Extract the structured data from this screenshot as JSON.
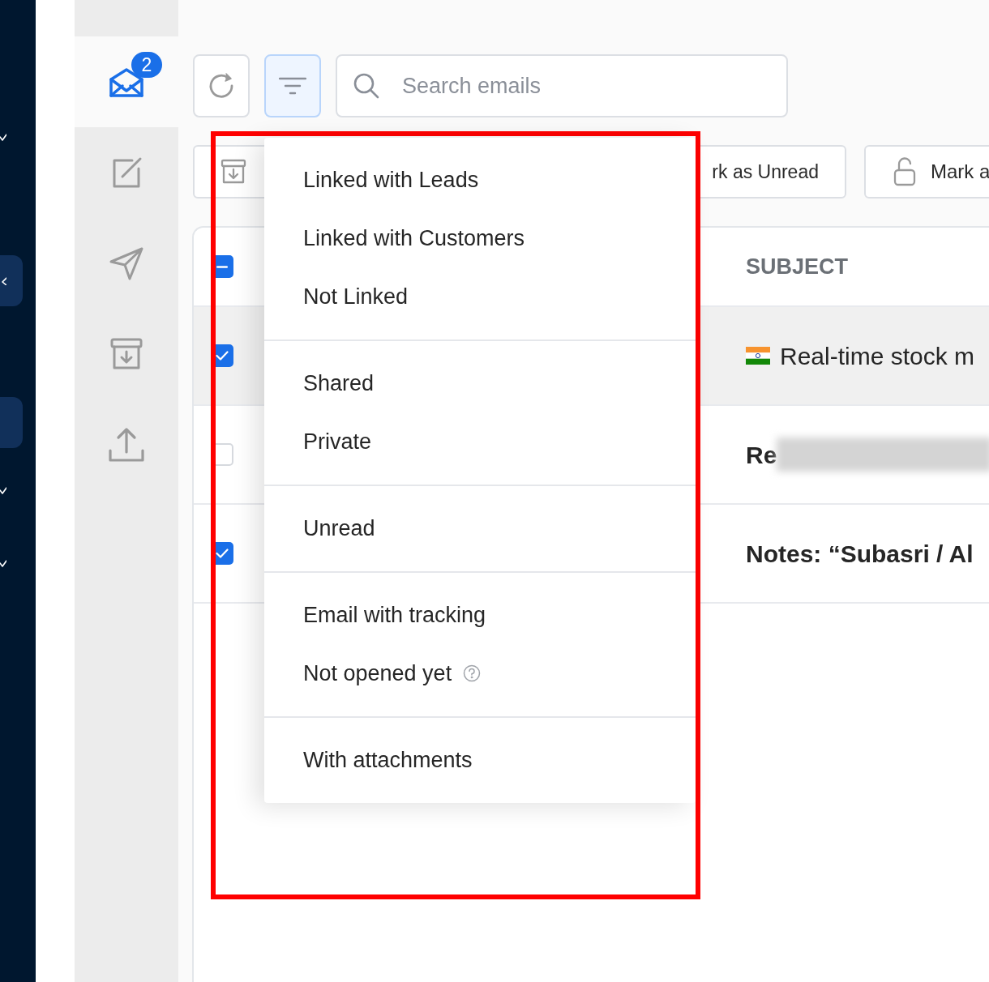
{
  "outer_nav": {
    "items": [
      {
        "kind": "expand",
        "selected": false
      },
      {
        "kind": "collapse",
        "selected": true
      },
      {
        "kind": "plain",
        "selected": true
      },
      {
        "kind": "expand",
        "selected": false
      },
      {
        "kind": "expand",
        "selected": false
      }
    ]
  },
  "rail": {
    "items": [
      {
        "kind": "inbox",
        "selected": true,
        "badge": "2"
      },
      {
        "kind": "compose",
        "selected": false
      },
      {
        "kind": "send",
        "selected": false
      },
      {
        "kind": "archive",
        "selected": false
      },
      {
        "kind": "upload",
        "selected": false
      }
    ]
  },
  "toolbar": {
    "filter_selected": true,
    "search": {
      "placeholder": "Search emails"
    }
  },
  "actions": [
    {
      "kind": "archive"
    },
    {
      "kind": "unread",
      "label": "rk as Unread"
    },
    {
      "kind": "lock",
      "label": "Mark a"
    }
  ],
  "table": {
    "header_checkbox": {
      "indeterminate": true
    },
    "columns": [
      "SUBJECT"
    ],
    "rows": [
      {
        "checked": true,
        "selected": true,
        "unread": false,
        "flag": true,
        "subject": "Real-time stock m"
      },
      {
        "checked": false,
        "selected": false,
        "unread": true,
        "redacted": true,
        "subject": "Re"
      },
      {
        "checked": true,
        "selected": false,
        "unread": true,
        "subject": "Notes: “Subasri / Al"
      }
    ]
  },
  "filter_menu": {
    "groups": [
      {
        "items": [
          {
            "label": "Linked with Leads"
          },
          {
            "label": "Linked with Customers"
          },
          {
            "label": "Not Linked"
          }
        ]
      },
      {
        "items": [
          {
            "label": "Shared"
          },
          {
            "label": "Private"
          }
        ]
      },
      {
        "items": [
          {
            "label": "Unread"
          }
        ]
      },
      {
        "items": [
          {
            "label": "Email with tracking"
          },
          {
            "label": "Not opened yet",
            "help": true
          }
        ]
      },
      {
        "items": [
          {
            "label": "With attachments"
          }
        ]
      }
    ]
  },
  "annotation": {
    "kind": "highlight"
  }
}
